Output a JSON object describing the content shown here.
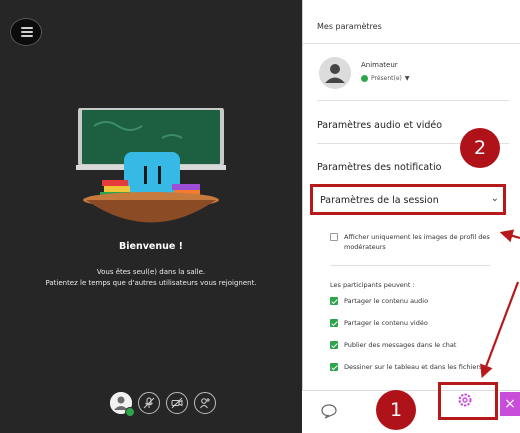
{
  "stage": {
    "welcome_title": "Bienvenue !",
    "welcome_line1": "Vous êtes seul(e) dans la salle.",
    "welcome_line2": "Patientez le temps que d'autres utilisateurs vous rejoignent.",
    "controls": [
      "avatar-icon",
      "microphone-off-icon",
      "camera-off-icon",
      "share-icon"
    ]
  },
  "panel": {
    "title": "Mes paramètres",
    "user": {
      "role": "Animateur",
      "status": "Présent(e)"
    },
    "sections": {
      "audio_video": "Paramètres audio et vidéo",
      "notifications": "Paramètres des notificatio",
      "session": "Paramètres de la session"
    },
    "moderator_option": "Afficher uniquement les images de profil des modérateurs",
    "participants_heading": "Les participants peuvent :",
    "participant_options": [
      {
        "label": "Partager le contenu audio",
        "checked": true
      },
      {
        "label": "Partager le contenu vidéo",
        "checked": true
      },
      {
        "label": "Publier des messages dans le chat",
        "checked": true
      },
      {
        "label": "Dessiner sur le tableau et dans les fichiers",
        "checked": true
      }
    ],
    "footer_icons": [
      "chat-icon",
      "gear-icon",
      "close-icon"
    ],
    "close_glyph": "×"
  },
  "annotations": {
    "step1": "1",
    "step2": "2",
    "highlight_color": "#b7191b"
  },
  "colors": {
    "stage_bg": "#262626",
    "accent_green": "#2ea54a",
    "close_purple": "#c84dd8",
    "marker_red": "#b01219"
  }
}
